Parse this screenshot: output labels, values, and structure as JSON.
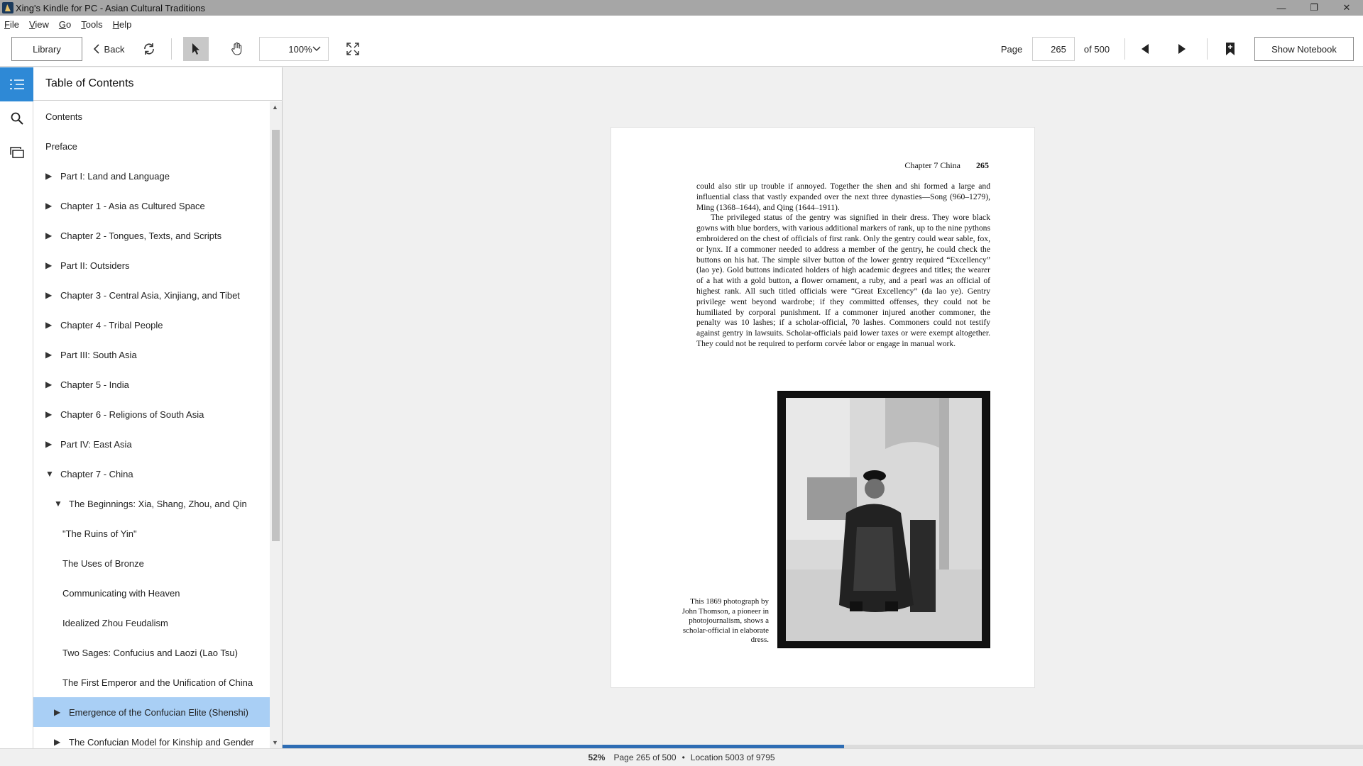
{
  "window": {
    "title": "Xing's Kindle for PC - Asian Cultural Traditions",
    "minimize": "—",
    "restore": "❐",
    "close": "✕"
  },
  "menu": [
    "File",
    "View",
    "Go",
    "Tools",
    "Help"
  ],
  "toolbar": {
    "library_label": "Library",
    "back_label": "Back",
    "zoom_value": "100%",
    "page_label": "Page",
    "page_value": "265",
    "page_total": "of 500",
    "notebook_label": "Show Notebook"
  },
  "toc": {
    "header": "Table of Contents",
    "items": [
      {
        "label": "Contents",
        "level": 0,
        "arrow": ""
      },
      {
        "label": "Preface",
        "level": 0,
        "arrow": ""
      },
      {
        "label": "Part I: Land and Language",
        "level": 1,
        "arrow": "▶"
      },
      {
        "label": "Chapter 1 - Asia as Cultured Space",
        "level": 1,
        "arrow": "▶"
      },
      {
        "label": "Chapter 2 - Tongues, Texts, and Scripts",
        "level": 1,
        "arrow": "▶"
      },
      {
        "label": "Part II: Outsiders",
        "level": 1,
        "arrow": "▶"
      },
      {
        "label": "Chapter 3 - Central Asia, Xinjiang, and Tibet",
        "level": 1,
        "arrow": "▶"
      },
      {
        "label": "Chapter 4 - Tribal People",
        "level": 1,
        "arrow": "▶"
      },
      {
        "label": "Part III: South Asia",
        "level": 1,
        "arrow": "▶"
      },
      {
        "label": "Chapter 5 - India",
        "level": 1,
        "arrow": "▶"
      },
      {
        "label": "Chapter 6 - Religions of South Asia",
        "level": 1,
        "arrow": "▶"
      },
      {
        "label": "Part IV: East Asia",
        "level": 1,
        "arrow": "▶"
      },
      {
        "label": "Chapter 7 - China",
        "level": 1,
        "arrow": "▼"
      },
      {
        "label": "The Beginnings: Xia, Shang, Zhou, and Qin",
        "level": 2,
        "arrow": "▼"
      },
      {
        "label": "\"The Ruins of Yin\"",
        "level": 3,
        "arrow": ""
      },
      {
        "label": "The Uses of Bronze",
        "level": 3,
        "arrow": ""
      },
      {
        "label": "Communicating with Heaven",
        "level": 3,
        "arrow": ""
      },
      {
        "label": "Idealized Zhou Feudalism",
        "level": 3,
        "arrow": ""
      },
      {
        "label": "Two Sages: Confucius and Laozi (Lao Tsu)",
        "level": 3,
        "arrow": ""
      },
      {
        "label": "The First Emperor and the Unification of China",
        "level": 3,
        "arrow": ""
      },
      {
        "label": "Emergence of the Confucian Elite (Shenshi)",
        "level": 2,
        "arrow": "▶",
        "selected": true
      },
      {
        "label": "The Confucian Model for Kinship and Gender",
        "level": 2,
        "arrow": "▶"
      }
    ]
  },
  "page": {
    "running_head": "Chapter 7   China",
    "page_number": "265",
    "paragraphs": [
      "could also stir up trouble if annoyed. Together the shen and shi formed a large and influential class that vastly expanded over the next three dynasties—Song (960–1279), Ming (1368–1644), and Qing (1644–1911).",
      "The privileged status of the gentry was signified in their dress. They wore black gowns with blue borders, with various additional markers of rank, up to the nine pythons embroidered on the chest of officials of first rank. Only the gentry could wear sable, fox, or lynx. If a commoner needed to address a member of the gentry, he could check the buttons on his hat. The simple silver button of the lower gentry required “Excellency” (lao ye). Gold buttons indicated holders of high academic degrees and titles; the wearer of a hat with a gold button, a flower ornament, a ruby, and a pearl was an official of highest rank. All such titled officials were “Great Excellency” (da lao ye). Gentry privilege went beyond wardrobe; if they committed offenses, they could not be humiliated by corporal punishment. If a commoner injured another commoner, the penalty was 10 lashes; if a scholar-official, 70 lashes. Commoners could not testify against gentry in lawsuits. Scholar-officials paid lower taxes or were exempt altogether. They could not be required to perform corvée labor or engage in manual work."
    ],
    "caption": "This 1869 photograph by John Thomson, a pioneer in photojournalism, shows a scholar-official in elaborate dress."
  },
  "status": {
    "percent": "52%",
    "page_info": "Page 265 of 500",
    "location": "Location 5003 of 9795",
    "progress_fraction": 0.52
  },
  "colors": {
    "accent": "#2e89d6",
    "selected_row": "#a9cff5",
    "progress": "#2e6db4"
  }
}
